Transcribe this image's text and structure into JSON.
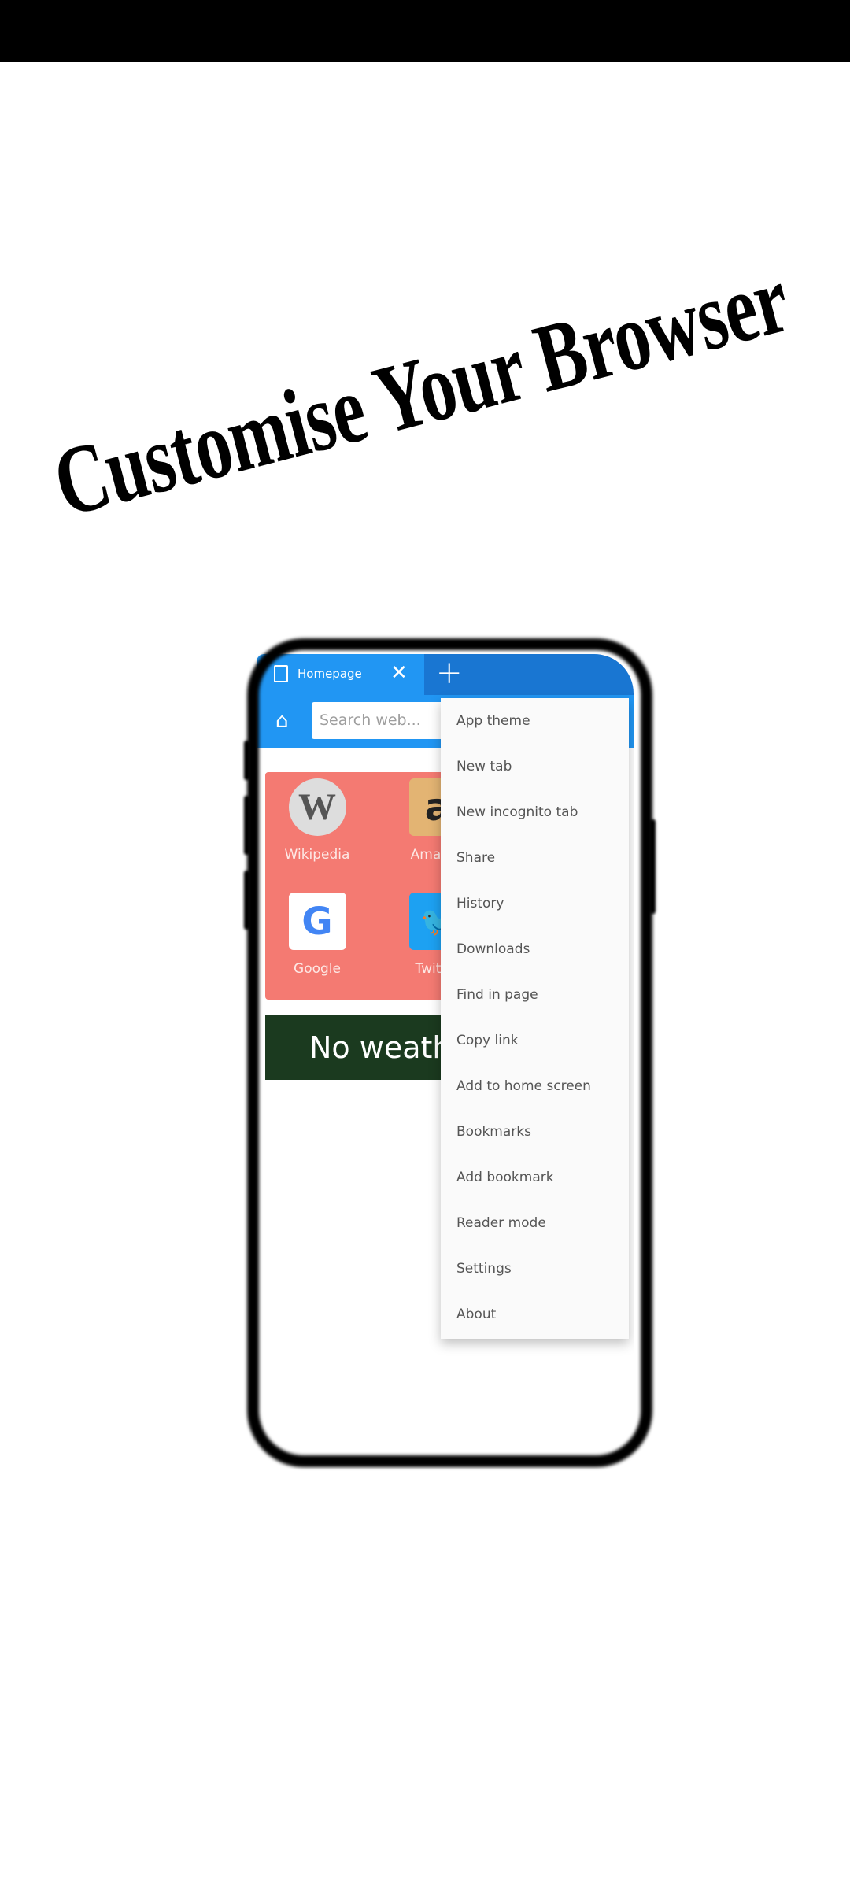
{
  "headline": "Customise Your Browser",
  "browser": {
    "tab_title": "Homepage",
    "tab_close": "✕",
    "new_tab": "+",
    "search_placeholder": "Search web...",
    "shortcuts": [
      {
        "label": "Wikipedia",
        "icon": "wikipedia-icon"
      },
      {
        "label": "Amazon",
        "icon": "amazon-icon"
      },
      {
        "label": "Google",
        "icon": "google-icon"
      },
      {
        "label": "Twitter",
        "icon": "twitter-icon"
      }
    ],
    "weather_text": "No weather",
    "colors": {
      "tab_active": "#2196f3",
      "tab_bar": "#1976d2",
      "shortcuts_bg": "#f47a72",
      "weather_bg": "#1b3a1f"
    }
  },
  "menu": {
    "items": [
      "App theme",
      "New tab",
      "New incognito tab",
      "Share",
      "History",
      "Downloads",
      "Find in page",
      "Copy link",
      "Add to home screen",
      "Bookmarks",
      "Add bookmark",
      "Reader mode",
      "Settings",
      "About"
    ]
  }
}
